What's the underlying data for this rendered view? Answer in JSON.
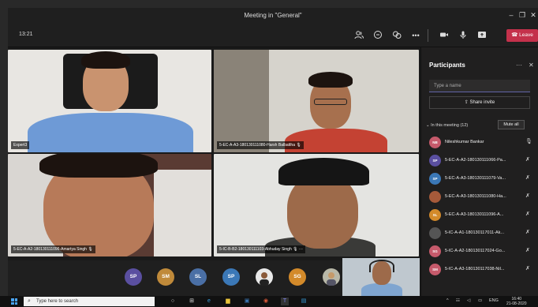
{
  "window": {
    "title": "Meeting in \"General\""
  },
  "toolbar": {
    "time": "13:21",
    "leave_label": "Leave"
  },
  "tiles": [
    {
      "name": "Expert3"
    },
    {
      "name": "5-EC-A-A3-180130111080-Harsh Balbattha"
    },
    {
      "name": "5-EC-A-A2-180130111096-Amartya Singh"
    },
    {
      "name": "5-IC-B-B2-180130111103-Abhuday Singh"
    }
  ],
  "strip_avatars": [
    {
      "initials": "SP",
      "color": "#5a4fa0"
    },
    {
      "initials": "SM",
      "color": "#c08a3a"
    },
    {
      "initials": "SL",
      "color": "#4a6fa5"
    },
    {
      "initials": "SP",
      "color": "#3b78b7"
    },
    {
      "initials": "",
      "color": "#ddd"
    },
    {
      "initials": "SG",
      "color": "#d38a2a"
    },
    {
      "initials": "",
      "color": "#888"
    }
  ],
  "participants": {
    "title": "Participants",
    "search_placeholder": "Type a name",
    "share_label": "Share invite",
    "section_label": "In this meeting (12)",
    "mute_all_label": "Mute all",
    "list": [
      {
        "initials": "NB",
        "color": "#c65a6b",
        "name": "Nileshkumar Bankar"
      },
      {
        "initials": "SP",
        "color": "#5a4fa0",
        "name": "5-EC-A-A2-180130111066-Pa..."
      },
      {
        "initials": "SP",
        "color": "#3b78b7",
        "name": "5-EC-A-A3-180130111079-Va..."
      },
      {
        "initials": "",
        "color": "#a65a3a",
        "name": "5-EC-A-A3-180130111080-Ha..."
      },
      {
        "initials": "SL",
        "color": "#d38a2a",
        "name": "5-EC-A-A3-180130111096-A..."
      },
      {
        "initials": "",
        "color": "#555",
        "name": "5-IC-A-A1-180130117011-Ak..."
      },
      {
        "initials": "SG",
        "color": "#c65a6b",
        "name": "5-IC-A-A2-180130117024-Go..."
      },
      {
        "initials": "SM",
        "color": "#c65a6b",
        "name": "5-IC-A-A3-180130117038-Nil..."
      }
    ]
  },
  "taskbar": {
    "search_placeholder": "Type here to search",
    "lang": "ENG",
    "time": "16:40",
    "date": "21-08-2020"
  }
}
